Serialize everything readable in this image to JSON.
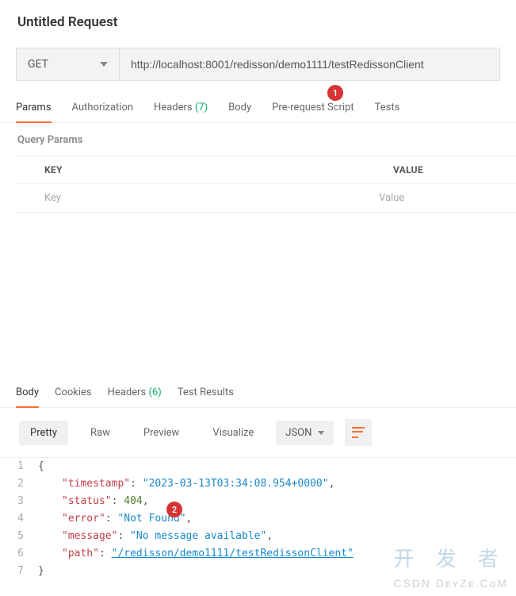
{
  "header": {
    "title": "Untitled Request"
  },
  "request": {
    "method": "GET",
    "url": "http://localhost:8001/redisson/demo1111/testRedissonClient"
  },
  "tabs": {
    "params": "Params",
    "authorization": "Authorization",
    "headers_label": "Headers",
    "headers_count": "(7)",
    "body": "Body",
    "prerequest": "Pre-request Script",
    "tests": "Tests"
  },
  "annotations": {
    "marker1": "1",
    "marker2": "2"
  },
  "query_params": {
    "section_label": "Query Params",
    "columns": {
      "key": "KEY",
      "value": "VALUE"
    },
    "placeholder": {
      "key": "Key",
      "value": "Value"
    }
  },
  "response_tabs": {
    "body": "Body",
    "cookies": "Cookies",
    "headers_label": "Headers",
    "headers_count": "(6)",
    "test_results": "Test Results"
  },
  "response_toolbar": {
    "pretty": "Pretty",
    "raw": "Raw",
    "preview": "Preview",
    "visualize": "Visualize",
    "format": "JSON"
  },
  "response_body": {
    "timestamp_key": "\"timestamp\"",
    "timestamp_val": "\"2023-03-13T03:34:08.954+0000\"",
    "status_key": "\"status\"",
    "status_val": "404",
    "error_key": "\"error\"",
    "error_val": "\"Not Found\"",
    "message_key": "\"message\"",
    "message_val": "\"No message available\"",
    "path_key": "\"path\"",
    "path_val": "\"/redisson/demo1111/testRedissonClient\""
  },
  "watermark": {
    "text1": "开 发 者",
    "text2": "CSDN  DᴇʏZᴇ.CᴏM"
  }
}
